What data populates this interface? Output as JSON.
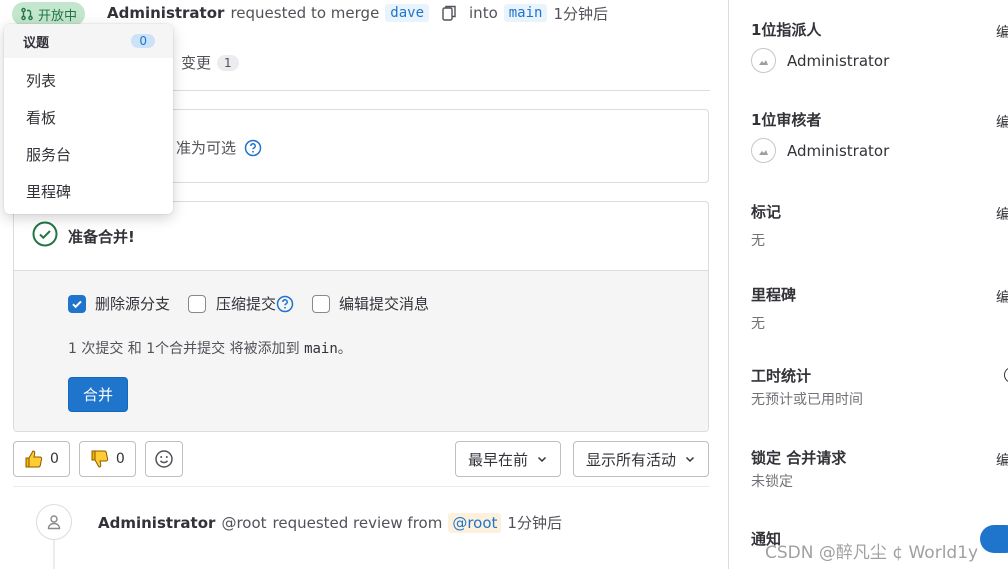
{
  "header": {
    "status": "开放中",
    "author": "Administrator",
    "requested_text": "requested to merge",
    "source_branch": "dave",
    "into_text": "into",
    "target_branch": "main",
    "time": "1分钟后"
  },
  "tabs": {
    "changes_label": "变更",
    "changes_count": "1"
  },
  "approval": {
    "text": "准为可选"
  },
  "merge": {
    "title": "准备合并!",
    "options": [
      {
        "label": "删除源分支",
        "checked": true
      },
      {
        "label": "压缩提交",
        "checked": false
      },
      {
        "label": "编辑提交消息",
        "checked": false
      }
    ],
    "commit_info_prefix": "1 次提交 和 1个合并提交 将被添加到 ",
    "commit_info_branch": "main",
    "commit_info_suffix": "。",
    "button_label": "合并"
  },
  "reactions": {
    "thumbs_up": "0",
    "thumbs_down": "0"
  },
  "sort_dropdown": "最早在前",
  "filter_dropdown": "显示所有活动",
  "timeline": {
    "author": "Administrator",
    "handle": "@root",
    "text": "requested review from",
    "mention": "@root",
    "time": "1分钟后"
  },
  "issues_menu": {
    "title": "议题",
    "count": "0",
    "items": [
      "列表",
      "看板",
      "服务台",
      "里程碑"
    ]
  },
  "sidebar": {
    "assignee_title": "1位指派人",
    "assignee_name": "Administrator",
    "reviewer_title": "1位审核者",
    "reviewer_name": "Administrator",
    "labels_title": "标记",
    "labels_value": "无",
    "milestone_title": "里程碑",
    "milestone_value": "无",
    "time_title": "工时统计",
    "time_value": "无预计或已用时间",
    "lock_title": "锁定 合并请求",
    "lock_value": "未锁定",
    "notify_title": "通知",
    "edit_label": "编辑"
  },
  "colors": {
    "primary": "#1f75cb",
    "success": "#217645"
  },
  "watermark": "CSDN @醉凡尘 ¢ World1y"
}
